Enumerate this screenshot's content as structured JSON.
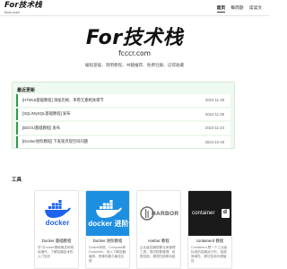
{
  "topbar": {
    "logo_main": "For技术栈",
    "logo_sub": "fcccr.com",
    "nav": [
      {
        "label": "首页",
        "active": true
      },
      {
        "label": "每周题",
        "active": false
      },
      {
        "label": "读读文",
        "active": false
      }
    ]
  },
  "hero": {
    "logo_main": "For技术栈",
    "logo_sub": "fcccr.com",
    "subtitle": "编程基础、简明教程、书籍推荐、免费社群、记得收藏"
  },
  "updates": {
    "title": "最近更新",
    "items": [
      {
        "text": "[HTML5基础教程] 添加历帧、率卷元素相关章节",
        "date": "2024-11-29"
      },
      {
        "text": "[SQL/MySQL基础教程] 发布",
        "date": "2024-11-28"
      },
      {
        "text": "[BGOU基础教程] 发布",
        "date": "2024-11-24"
      },
      {
        "text": "[Docker进阶教程] 下发现点现空间问题",
        "date": "2024-10-18"
      }
    ]
  },
  "tools": {
    "title": "工具",
    "cards": [
      {
        "name": "Docker 基础教程",
        "logo_text": "docker",
        "desc": "学习Docker基础概念和常用操作，了解容器技术的入门知识"
      },
      {
        "name": "Docker 进阶教程",
        "logo_text": "docker 进阶",
        "desc": "Docker网络、Compose和Dockerfile，深入了解容器编排、镜像构建与最佳实践"
      },
      {
        "name": "Harbor 教程",
        "logo_text": "HARBOR",
        "desc": "企业级容器镜像仓库管理工具，提供镜像管理、权限控制、漏洞扫描等功能"
      },
      {
        "name": "containerd 教程",
        "logo_text": "container",
        "desc": "Containerd 是一个工业级标准的容器运行时，强调简单性、健壮性和可移植性"
      }
    ]
  },
  "colors": {
    "accent_green": "#2e9b4a",
    "updates_bg": "#eef9ef",
    "docker_blue": "#1d63ed",
    "docker_bg": "#1d8fe0"
  }
}
